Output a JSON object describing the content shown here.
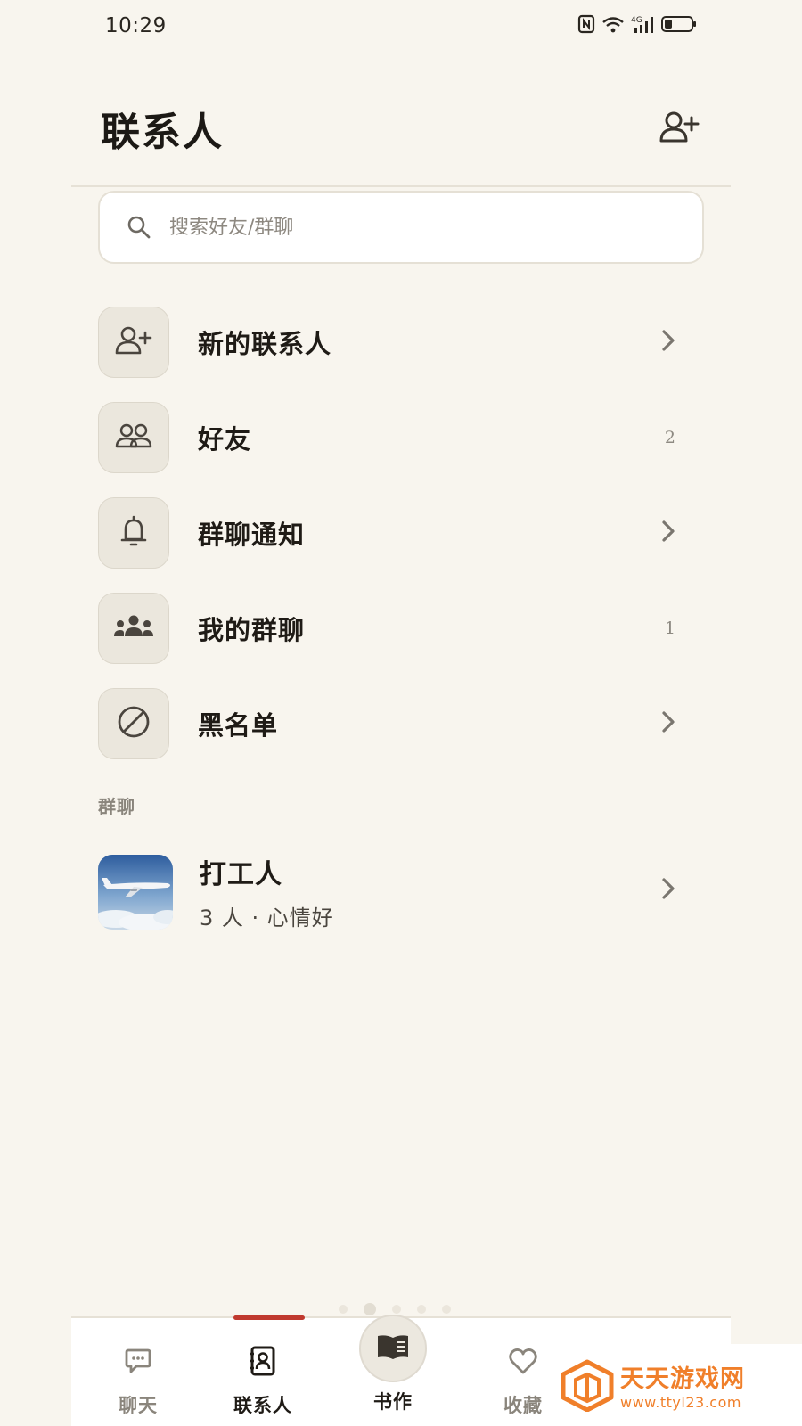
{
  "status_bar": {
    "time": "10:29",
    "signal_label": "4G",
    "wifi_label": "6"
  },
  "header": {
    "title": "联系人",
    "add_icon": "add-person-icon"
  },
  "search": {
    "placeholder": "搜索好友/群聊",
    "value": ""
  },
  "menu": {
    "items": [
      {
        "label": "新的联系人",
        "icon": "add-person-icon",
        "trailing": "chevron"
      },
      {
        "label": "好友",
        "icon": "friends-icon",
        "trailing": "count",
        "count": "2"
      },
      {
        "label": "群聊通知",
        "icon": "bell-icon",
        "trailing": "chevron"
      },
      {
        "label": "我的群聊",
        "icon": "group-icon",
        "trailing": "count",
        "count": "1"
      },
      {
        "label": "黑名单",
        "icon": "block-icon",
        "trailing": "chevron"
      }
    ]
  },
  "section": {
    "group_chats_label": "群聊"
  },
  "groups": [
    {
      "name": "打工人",
      "subtitle": "3 人 · 心情好",
      "avatar": "airplane-photo"
    }
  ],
  "tabs": [
    {
      "label": "聊天",
      "icon": "chat-bubble-icon",
      "active": false
    },
    {
      "label": "联系人",
      "icon": "contacts-book-icon",
      "active": true
    },
    {
      "label": "书作",
      "icon": "open-book-icon",
      "active": false
    },
    {
      "label": "收藏",
      "icon": "heart-icon",
      "active": false
    }
  ],
  "watermark": {
    "title": "天天游戏网",
    "url": "www.ttyl23.com"
  },
  "colors": {
    "background": "#f8f5ee",
    "accent_indicator": "#c0392f",
    "watermark_orange": "#f07f2a"
  }
}
